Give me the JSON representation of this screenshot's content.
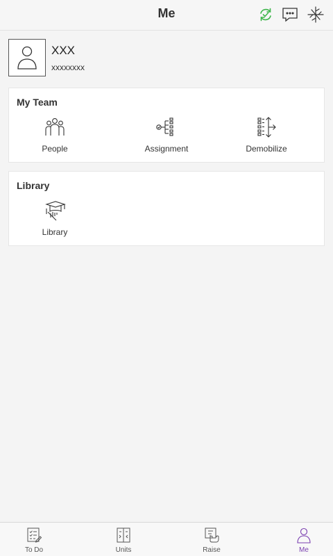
{
  "header": {
    "title": "Me",
    "icons": [
      "sync-icon",
      "chat-icon",
      "network-icon"
    ],
    "accent_color": "#3db54a"
  },
  "profile": {
    "name": "XXX",
    "subtitle": "xxxxxxxx"
  },
  "my_team": {
    "title": "My Team",
    "items": [
      {
        "label": "People",
        "icon": "people-icon"
      },
      {
        "label": "Assignment",
        "icon": "assignment-icon"
      },
      {
        "label": "Demobilize",
        "icon": "demobilize-icon"
      }
    ]
  },
  "library": {
    "title": "Library",
    "items": [
      {
        "label": "Library",
        "icon": "library-icon"
      }
    ]
  },
  "tabbar": {
    "active": "Me",
    "active_color": "#7a3fb0",
    "tabs": [
      {
        "label": "To Do",
        "icon": "todo-icon"
      },
      {
        "label": "Units",
        "icon": "units-icon"
      },
      {
        "label": "Raise",
        "icon": "raise-icon"
      },
      {
        "label": "Me",
        "icon": "me-icon"
      }
    ]
  }
}
